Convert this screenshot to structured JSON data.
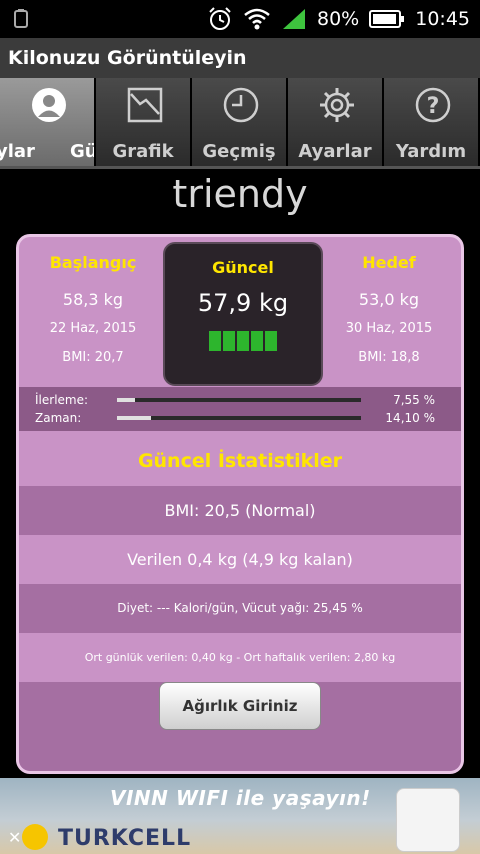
{
  "status": {
    "battery": "80%",
    "time": "10:45"
  },
  "app": {
    "title": "Kilonuzu Görüntüleyin"
  },
  "tabs": [
    {
      "label": "ylar",
      "label2": "Gü",
      "icon": "user-icon"
    },
    {
      "label": "Grafik",
      "icon": "chart-icon"
    },
    {
      "label": "Geçmiş",
      "icon": "clock-icon"
    },
    {
      "label": "Ayarlar",
      "icon": "gear-icon"
    },
    {
      "label": "Yardım",
      "icon": "help-icon"
    }
  ],
  "username": "triendy",
  "start": {
    "header": "Başlangıç",
    "weight": "58,3 kg",
    "date": "22 Haz, 2015",
    "bmi": "BMI: 20,7"
  },
  "current": {
    "header": "Güncel",
    "weight": "57,9 kg"
  },
  "target": {
    "header": "Hedef",
    "weight": "53,0 kg",
    "date": "30 Haz, 2015",
    "bmi": "BMI: 18,8"
  },
  "progress": [
    {
      "label": "İlerleme:",
      "value": "7,55 %",
      "fraction": 0.0755
    },
    {
      "label": "Zaman:",
      "value": "14,10 %",
      "fraction": 0.141
    }
  ],
  "stats": {
    "title": "Güncel İstatistikler",
    "bmi": "BMI: 20,5 (Normal)",
    "lost": "Verilen 0,4 kg (4,9 kg kalan)",
    "diet": "Diyet: --- Kalori/gün, Vücut yağı: 25,45 %",
    "avg": "Ort günlük verilen: 0,40 kg - Ort haftalık verilen: 2,80 kg"
  },
  "button": {
    "label": "Ağırlık Giriniz"
  },
  "ad": {
    "slogan": "VINN WIFI ile yaşayın!",
    "brand": "TURKCELL"
  }
}
